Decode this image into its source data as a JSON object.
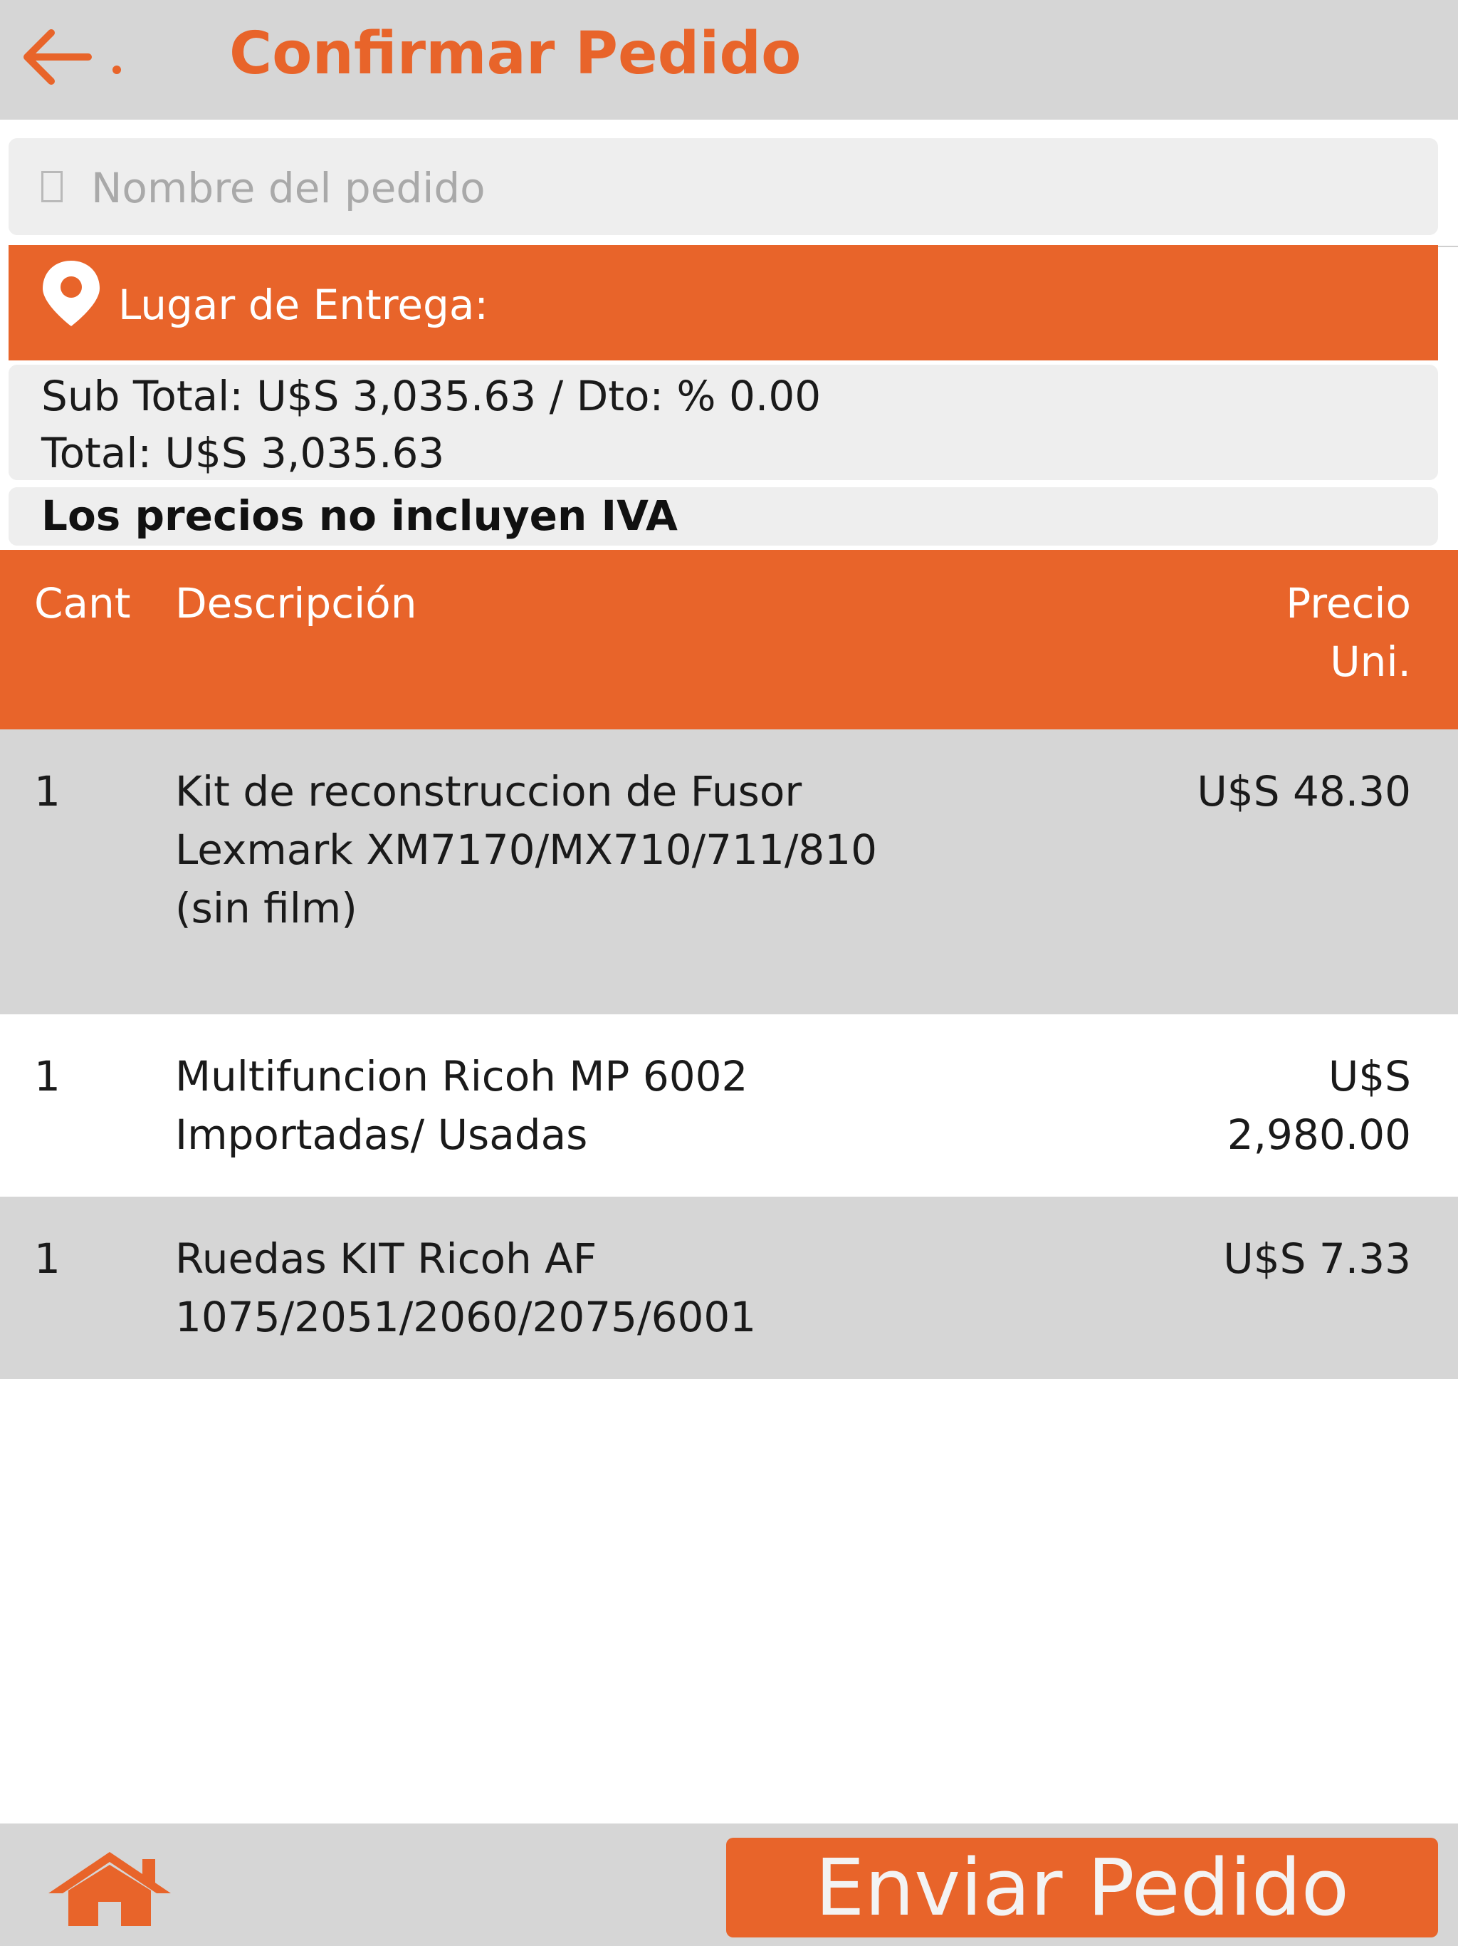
{
  "header": {
    "title": "Confirmar Pedido",
    "back_icon": "arrow-left-icon"
  },
  "order_name": {
    "placeholder": "Nombre del pedido",
    "value": ""
  },
  "delivery": {
    "icon": "map-pin-icon",
    "label": "Lugar de Entrega:"
  },
  "totals": {
    "subtotal_line": "Sub Total: U$S 3,035.63 / Dto: % 0.00",
    "total_line": "Total: U$S 3,035.63"
  },
  "notice": "Los precios no incluyen IVA",
  "table": {
    "headers": {
      "qty": "Cant",
      "description": "Descripción",
      "price": "Precio Uni."
    },
    "rows": [
      {
        "qty": "1",
        "description": "Kit de reconstruccion de Fusor Lexmark XM7170/MX710/711/810 (sin film)",
        "price": "U$S 48.30"
      },
      {
        "qty": "1",
        "description": "Multifuncion Ricoh MP 6002 Importadas/ Usadas",
        "price": "U$S 2,980.00"
      },
      {
        "qty": "1",
        "description": "Ruedas KIT Ricoh AF 1075/2051/2060/2075/6001",
        "price": "U$S 7.33"
      }
    ]
  },
  "footer": {
    "home_icon": "home-icon",
    "send_label": "Enviar Pedido"
  },
  "colors": {
    "accent": "#e8642a",
    "bar_gray": "#d6d6d6",
    "box_gray": "#eeeeee"
  }
}
